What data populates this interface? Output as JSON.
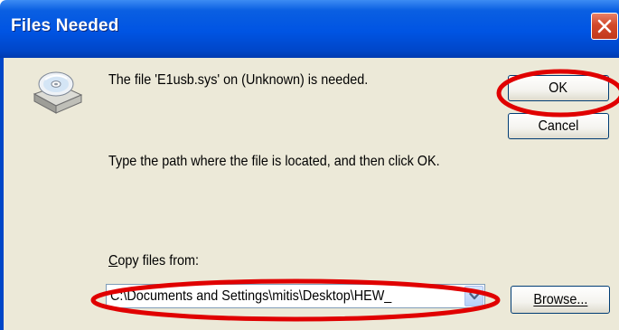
{
  "window": {
    "title": "Files Needed"
  },
  "dialog": {
    "message": "The file 'E1usb.sys' on (Unknown) is needed.",
    "instruction": "Type the path where the file is located, and then click OK.",
    "copy_from_label_prefix": "C",
    "copy_from_label_rest": "opy files from:",
    "copy_from_value": "C:\\Documents and Settings\\mitis\\Desktop\\HEW_",
    "ok_label": "OK",
    "cancel_label": "Cancel",
    "browse_label": "Browse..."
  },
  "icons": {
    "title_close": "close-icon",
    "disk": "cd-drive-icon",
    "dropdown": "chevron-down-icon"
  },
  "colors": {
    "titlebar": "#0054e3",
    "close_button": "#d2492a",
    "dialog_background": "#ece9d8",
    "annotation_ellipse": "#e00000"
  }
}
